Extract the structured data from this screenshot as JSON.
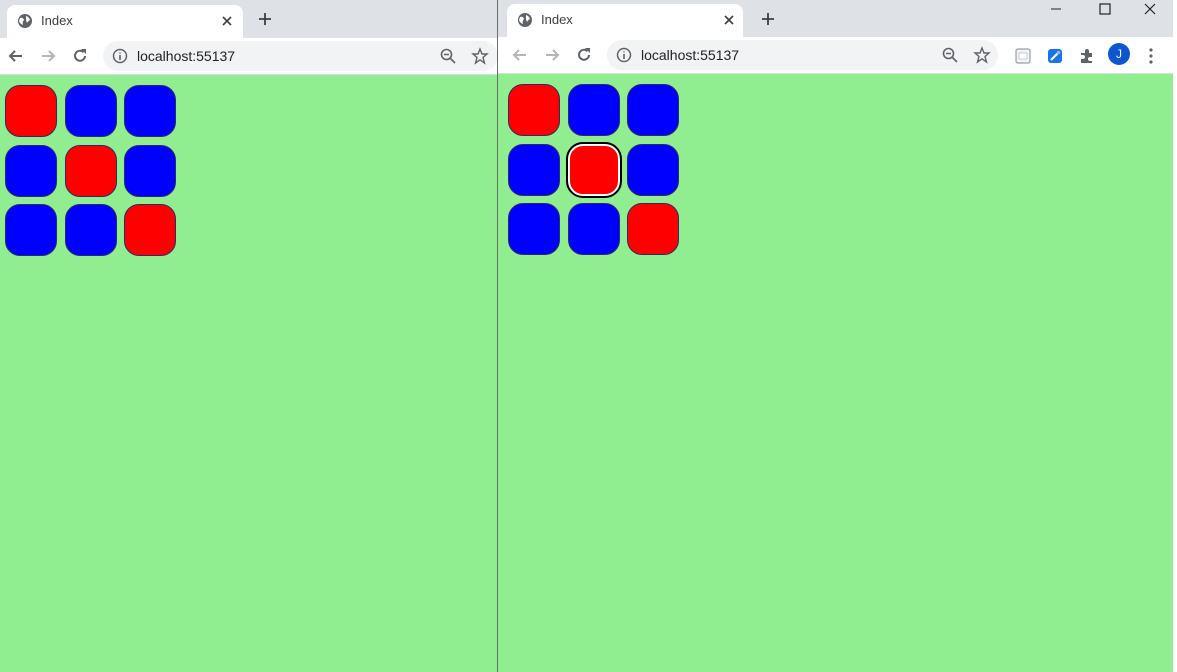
{
  "left_window": {
    "tab": {
      "title": "Index"
    },
    "address_bar": {
      "url": "localhost:55137"
    },
    "grid": [
      [
        "red",
        "blue",
        "blue"
      ],
      [
        "blue",
        "red",
        "blue"
      ],
      [
        "blue",
        "blue",
        "red"
      ]
    ],
    "selected_cell": null
  },
  "right_window": {
    "tab": {
      "title": "Index"
    },
    "address_bar": {
      "url": "localhost:55137"
    },
    "grid": [
      [
        "red",
        "blue",
        "blue"
      ],
      [
        "blue",
        "red",
        "blue"
      ],
      [
        "blue",
        "blue",
        "red"
      ]
    ],
    "selected_cell": [
      1,
      1
    ],
    "profile": {
      "initial": "J"
    }
  },
  "colors": {
    "page_background": "#90ee90",
    "red": "#ff0000",
    "blue": "#0000ff",
    "tabstrip": "#dee1e6",
    "avatar": "#0b57d0"
  }
}
